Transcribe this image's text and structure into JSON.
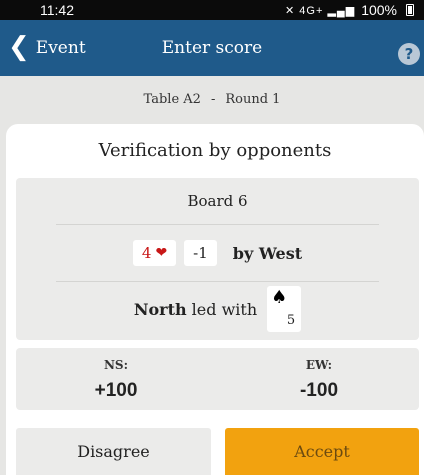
{
  "status_bar": {
    "time": "11:42",
    "network": "4G+",
    "battery": "100%"
  },
  "nav": {
    "back_label": "Event",
    "title": "Enter score",
    "help_glyph": "?"
  },
  "table_round": {
    "table": "Table A2",
    "separator": "-",
    "round": "Round 1"
  },
  "verification": {
    "title": "Verification by opponents",
    "board": "Board 6",
    "contract_level": "4",
    "contract_suit_icon": "heart-icon",
    "result": "-1",
    "declarer_text": "by West",
    "lead_player": "North",
    "lead_text": " led with",
    "lead_card_suit_icon": "spade-icon",
    "lead_card_rank": "5"
  },
  "scores": {
    "ns_label": "NS:",
    "ns_value": "+100",
    "ew_label": "EW:",
    "ew_value": "-100"
  },
  "actions": {
    "disagree_label": "Disagree",
    "accept_label": "Accept"
  },
  "colors": {
    "nav": "#1f5a8a",
    "accent": "#f2a20f",
    "heart": "#c81717"
  }
}
